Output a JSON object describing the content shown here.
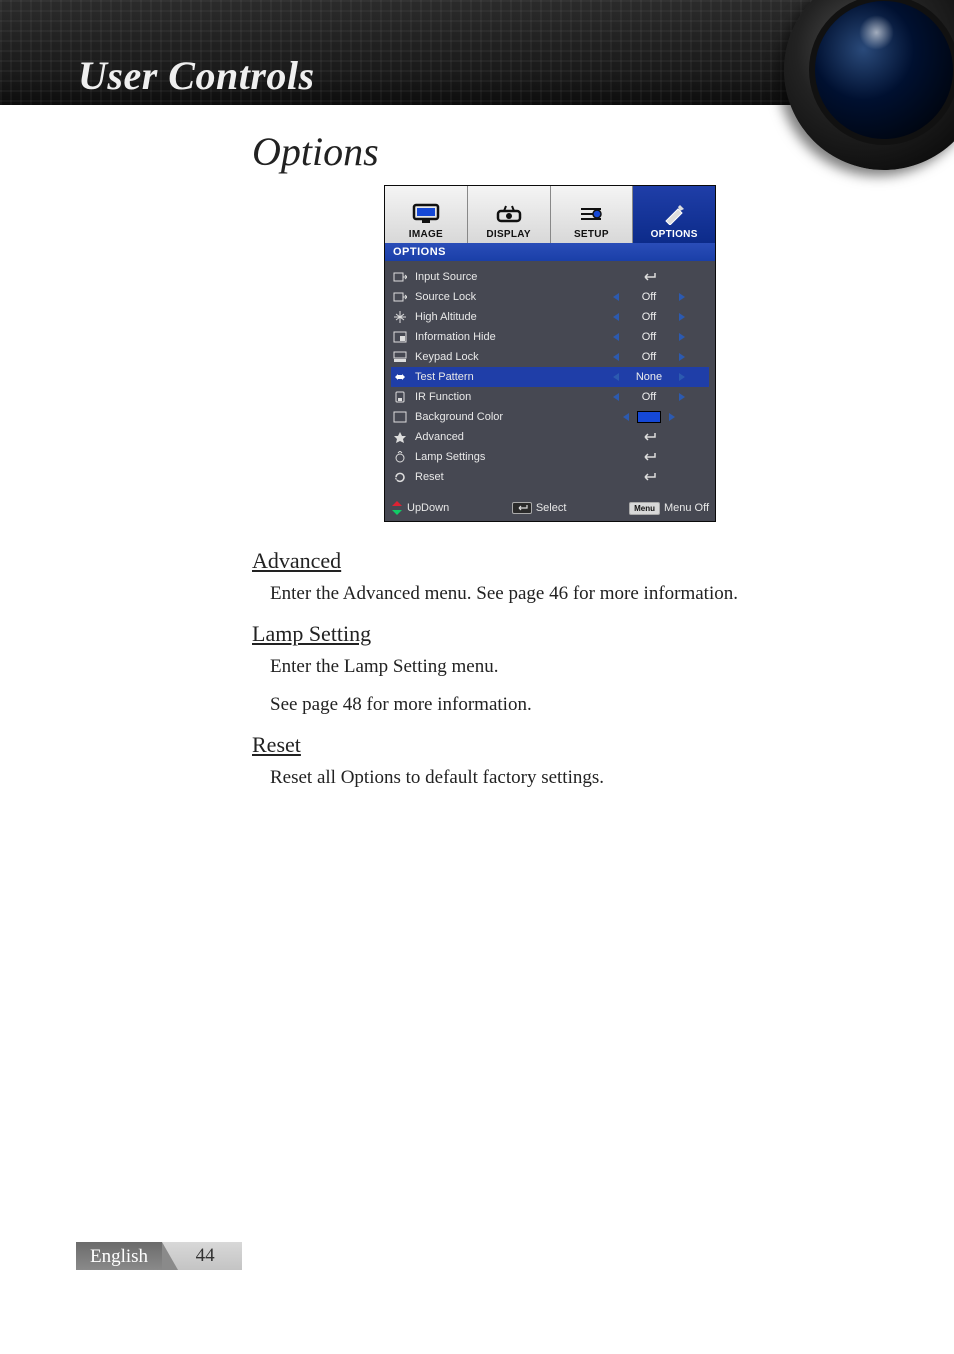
{
  "banner": {
    "title": "User Controls"
  },
  "section_title": "Options",
  "osd": {
    "tabs": [
      {
        "label": "IMAGE"
      },
      {
        "label": "DISPLAY"
      },
      {
        "label": "SETUP"
      },
      {
        "label": "OPTIONS"
      }
    ],
    "subhead": "OPTIONS",
    "rows": [
      {
        "label": "Input Source",
        "kind": "enter"
      },
      {
        "label": "Source Lock",
        "kind": "lr",
        "value": "Off"
      },
      {
        "label": "High Altitude",
        "kind": "lr",
        "value": "Off"
      },
      {
        "label": "Information Hide",
        "kind": "lr",
        "value": "Off"
      },
      {
        "label": "Keypad Lock",
        "kind": "lr",
        "value": "Off"
      },
      {
        "label": "Test Pattern",
        "kind": "lr",
        "value": "None",
        "selected": true
      },
      {
        "label": "IR Function",
        "kind": "lr",
        "value": "Off"
      },
      {
        "label": "Background Color",
        "kind": "lr",
        "value": "swatch"
      },
      {
        "label": "Advanced",
        "kind": "enter"
      },
      {
        "label": "Lamp Settings",
        "kind": "enter"
      },
      {
        "label": "Reset",
        "kind": "enter"
      }
    ],
    "footer": {
      "updown": "UpDown",
      "select": "Select",
      "menu_key": "Menu",
      "menu_off": "Menu Off"
    }
  },
  "doc": [
    {
      "heading": "Advanced",
      "paras": [
        "Enter the Advanced menu. See page 46 for more information."
      ]
    },
    {
      "heading": "Lamp Setting",
      "paras": [
        "Enter the Lamp Setting menu.",
        "See page 48 for more information."
      ]
    },
    {
      "heading": "Reset",
      "paras": [
        "Reset all Options to default factory settings."
      ]
    }
  ],
  "footer": {
    "language": "English",
    "page": "44"
  }
}
